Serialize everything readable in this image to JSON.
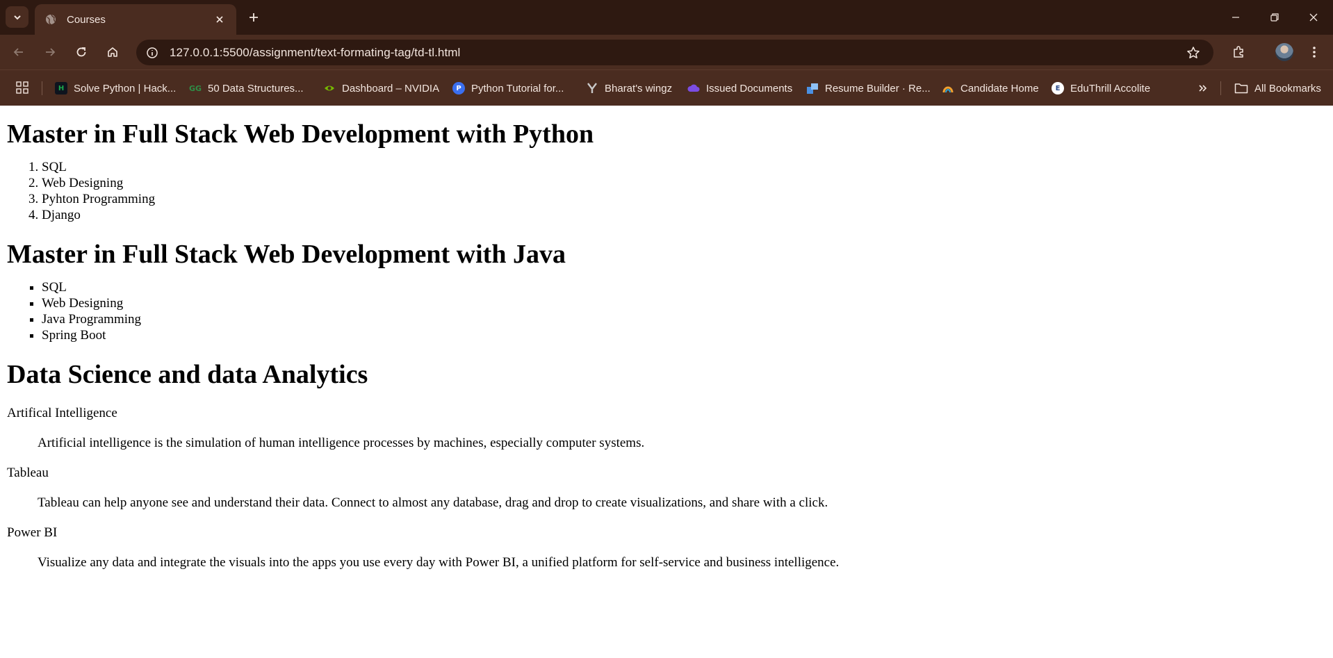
{
  "browser": {
    "tab_title": "Courses",
    "url": "127.0.0.1:5500/assignment/text-formating-tag/td-tl.html",
    "bookmarks": [
      {
        "label": "Solve Python | Hack...",
        "icon": "hackerrank-icon",
        "color": "#1ba94c"
      },
      {
        "label": "50 Data Structures...",
        "icon": "geeksforgeeks-icon",
        "color": "#2f8d46"
      },
      {
        "label": "Dashboard – NVIDIA",
        "icon": "nvidia-icon",
        "color": "#76b900"
      },
      {
        "label": "Python Tutorial for...",
        "icon": "python-tutorial-icon",
        "color": "#3a6ff0"
      },
      {
        "label": "Bharat's wingz",
        "icon": "wingz-icon",
        "color": "#c9c9c9"
      },
      {
        "label": "Issued Documents",
        "icon": "digilocker-icon",
        "color": "#7b4de3"
      },
      {
        "label": "Resume Builder · Re...",
        "icon": "resume-builder-icon",
        "color": "#4a90e2"
      },
      {
        "label": "Candidate Home",
        "icon": "candidate-home-icon",
        "color": "#f0a030"
      },
      {
        "label": "EduThrill Accolite",
        "icon": "eduthrill-icon",
        "color": "#ffffff"
      }
    ],
    "all_bookmarks_label": "All Bookmarks"
  },
  "page": {
    "section1": {
      "heading": "Master in Full Stack Web Development with Python",
      "items": [
        "SQL",
        "Web Designing",
        "Pyhton Programming",
        "Django"
      ]
    },
    "section2": {
      "heading": "Master in Full Stack Web Development with Java",
      "items": [
        "SQL",
        "Web Designing",
        "Java Programming",
        "Spring Boot"
      ]
    },
    "section3": {
      "heading": "Data Science and data Analytics",
      "terms": [
        {
          "term": "Artifical Intelligence",
          "definition": "Artificial intelligence is the simulation of human intelligence processes by machines, especially computer systems."
        },
        {
          "term": "Tableau",
          "definition": "Tableau can help anyone see and understand their data. Connect to almost any database, drag and drop to create visualizations, and share with a click."
        },
        {
          "term": "Power BI",
          "definition": "Visualize any data and integrate the visuals into the apps you use every day with Power BI, a unified platform for self-service and business intelligence."
        }
      ]
    }
  }
}
